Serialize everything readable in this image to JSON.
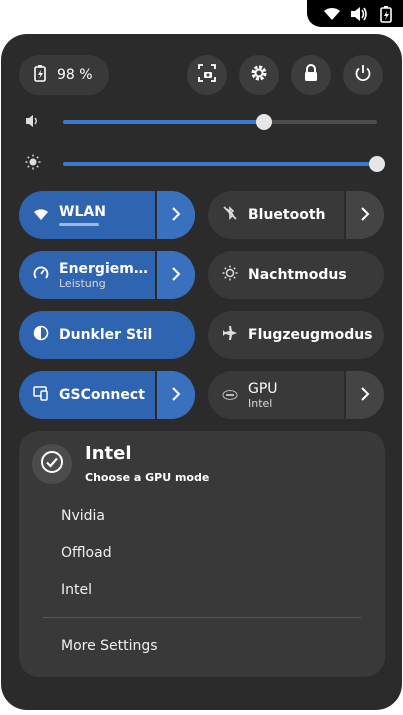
{
  "topbar": {
    "icons": [
      "wifi-icon",
      "volume-icon",
      "battery-icon"
    ]
  },
  "status": {
    "battery_percent": "98 %"
  },
  "header_buttons": [
    "screenshot-icon",
    "settings-icon",
    "lock-icon",
    "power-icon"
  ],
  "sliders": {
    "volume": {
      "level": 0.64
    },
    "brightness": {
      "level": 1.0
    }
  },
  "tiles": {
    "wlan": {
      "label": "WLAN"
    },
    "power": {
      "label": "Energiem…",
      "sub": "Leistung"
    },
    "dark": {
      "label": "Dunkler Stil"
    },
    "gsconnect": {
      "label": "GSConnect"
    },
    "bluetooth": {
      "label": "Bluetooth"
    },
    "night": {
      "label": "Nachtmodus"
    },
    "airplane": {
      "label": "Flugzeugmodus"
    },
    "gpu": {
      "label": "GPU",
      "sub": "Intel"
    }
  },
  "gpu_menu": {
    "title": "Intel",
    "subtitle": "Choose a GPU mode",
    "options": [
      "Nvidia",
      "Offload",
      "Intel"
    ],
    "more": "More Settings"
  },
  "colors": {
    "accent": "#2e64b0",
    "panel": "#2b2b2b"
  }
}
